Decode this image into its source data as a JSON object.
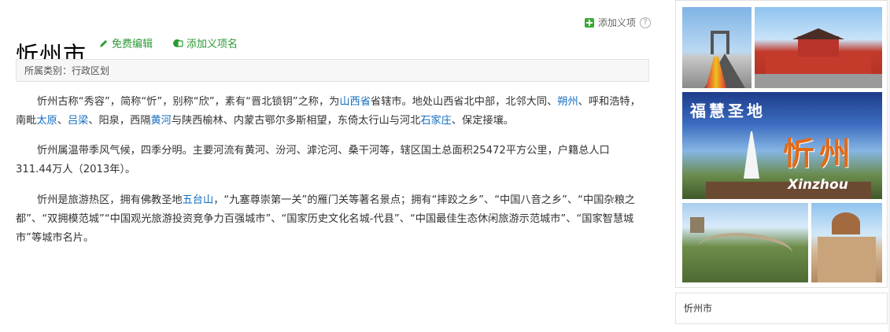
{
  "main": {
    "title": "忻州市",
    "edit_label": "免费编辑",
    "add_sense_label": "添加义项名",
    "add_sense_top_label": "添加义项",
    "help_icon": "?",
    "category": "所属类别：行政区划",
    "paragraphs": [
      [
        {
          "t": "忻州古称“秀容”，简称“忻”，别称“欣”，素有“晋北锁钥”之称，为"
        },
        {
          "t": "山西省",
          "link": true
        },
        {
          "t": "省辖市。地处山西省北中部，北邻大同、"
        },
        {
          "t": "朔州",
          "link": true
        },
        {
          "t": "、呼和浩特，南毗"
        },
        {
          "t": "太原",
          "link": true
        },
        {
          "t": "、"
        },
        {
          "t": "吕梁",
          "link": true
        },
        {
          "t": "、阳泉，西隔"
        },
        {
          "t": "黄河",
          "link": true
        },
        {
          "t": "与陕西榆林、内蒙古鄂尔多斯相望，东倚太行山与河北"
        },
        {
          "t": "石家庄",
          "link": true
        },
        {
          "t": "、保定接壤。"
        }
      ],
      [
        {
          "t": "忻州属温带季风气候，四季分明。主要河流有黄河、汾河、滹沱河、桑干河等，辖区国土总面积25472平方公里，户籍总人口311.44万人（2013年）。"
        }
      ],
      [
        {
          "t": "忻州是旅游热区，拥有佛教圣地"
        },
        {
          "t": "五台山",
          "link": true
        },
        {
          "t": "，“九塞尊崇第一关”的雁门关等著名景点；拥有“摔跤之乡”、“中国八音之乡”、“中国杂粮之都”、“双拥模范城”“中国观光旅游投资竞争力百强城市”、“国家历史文化名城-代县”、“中国最佳生态休闲旅游示范城市”、“国家智慧城市”等城市名片。"
        }
      ]
    ]
  },
  "sidebar": {
    "album_calligraphy": "福慧圣地",
    "album_city_name": "忻州",
    "album_pinyin": "Xinzhou",
    "caption": "忻州市"
  },
  "colors": {
    "link": "#136ec2",
    "edit_green": "#2a9a33",
    "accent_orange": "#e06a1a"
  }
}
